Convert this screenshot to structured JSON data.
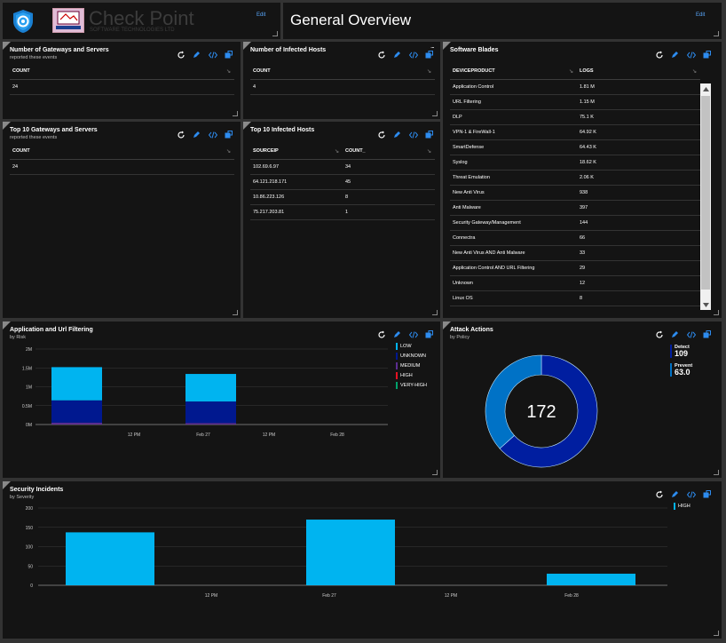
{
  "header": {
    "logo_text": "Check Point",
    "logo_tagline": "SOFTWARE TECHNOLOGIES LTD",
    "edit_left": "Edit",
    "page_title": "General Overview",
    "edit_right": "Edit"
  },
  "tiles": {
    "gateways_count": {
      "title": "Number of Gateways and Servers",
      "subtitle": "reported these events",
      "column": "COUNT",
      "value": "24"
    },
    "infected_count": {
      "title": "Number of Infected Hosts",
      "column": "COUNT",
      "value": "4",
      "more": "..."
    },
    "top_gateways": {
      "title": "Top 10 Gateways and Servers",
      "subtitle": "reported these events",
      "column": "COUNT",
      "value": "24"
    },
    "top_infected": {
      "title": "Top 10 Infected Hosts",
      "columns": [
        "SOURCEIP",
        "COUNT_"
      ],
      "rows": [
        [
          "102.69.6.97",
          "34"
        ],
        [
          "64.121.218.171",
          "45"
        ],
        [
          "10.86.223.126",
          "8"
        ],
        [
          "75.217.203.81",
          "1"
        ]
      ]
    },
    "software_blades": {
      "title": "Software Blades",
      "columns": [
        "DEVICEPRODUCT",
        "LOGS"
      ],
      "rows": [
        [
          "Application Control",
          "1.81 M"
        ],
        [
          "URL Filtering",
          "1.15 M"
        ],
        [
          "DLP",
          "75.1 K"
        ],
        [
          "VPN-1 & FireWall-1",
          "64.92 K"
        ],
        [
          "SmartDefense",
          "64.43 K"
        ],
        [
          "Syslog",
          "18.62 K"
        ],
        [
          "Threat Emulation",
          "2.06 K"
        ],
        [
          "New Anti Virus",
          "938"
        ],
        [
          "Anti Malware",
          "397"
        ],
        [
          "Security Gateway/Management",
          "144"
        ],
        [
          "Connectra",
          "66"
        ],
        [
          "New Anti Virus AND Anti Malware",
          "33"
        ],
        [
          "Application Control AND URL Filtering",
          "29"
        ],
        [
          "Unknown",
          "12"
        ],
        [
          "Linux OS",
          "8"
        ]
      ]
    },
    "app_url": {
      "title": "Application and Url Filtering",
      "subtitle": "by Risk"
    },
    "attack_actions": {
      "title": "Attack Actions",
      "subtitle": "by Policy",
      "center_value": "172"
    },
    "security_incidents": {
      "title": "Security Incidents",
      "subtitle": "by Severity"
    }
  },
  "colors": {
    "low": "#00b4f0",
    "unknown": "#00188f",
    "medium": "#5c2d91",
    "high": "#e81123",
    "very_high": "#00a36c",
    "detect": "#001ea0",
    "prevent": "#0072c6",
    "incident_high": "#00b4f0"
  },
  "chart_data": [
    {
      "type": "bar",
      "title": "Application and Url Filtering",
      "subtitle": "by Risk",
      "stacked": true,
      "y_ticks": [
        "0M",
        "0.5M",
        "1M",
        "1.5M",
        "2M"
      ],
      "ylim": [
        0,
        2000000
      ],
      "x_ticks": [
        "12 PM",
        "Feb 27",
        "12 PM",
        "Feb 28"
      ],
      "categories": [
        "Feb 26 slot",
        "Feb 27 slot"
      ],
      "series": [
        {
          "name": "LOW",
          "values": [
            880000,
            730000
          ]
        },
        {
          "name": "UNKNOWN",
          "values": [
            590000,
            570000
          ]
        },
        {
          "name": "MEDIUM",
          "values": [
            50000,
            40000
          ]
        },
        {
          "name": "HIGH",
          "values": [
            0,
            0
          ]
        },
        {
          "name": "VERY-HIGH",
          "values": [
            0,
            0
          ]
        }
      ],
      "legend": "right"
    },
    {
      "type": "pie",
      "title": "Attack Actions",
      "subtitle": "by Policy",
      "donut": true,
      "total": 172,
      "slices": [
        {
          "name": "Detect",
          "value": 109
        },
        {
          "name": "Prevent",
          "value": 63.0
        }
      ],
      "legend": "right"
    },
    {
      "type": "bar",
      "title": "Security Incidents",
      "subtitle": "by Severity",
      "y_ticks": [
        "0",
        "50",
        "100",
        "150",
        "200"
      ],
      "ylim": [
        0,
        200
      ],
      "x_ticks": [
        "12 PM",
        "Feb 27",
        "12 PM",
        "Feb 28"
      ],
      "categories": [
        "Feb 26 slot",
        "Feb 27 slot",
        "Feb 28 slot"
      ],
      "series": [
        {
          "name": "HIGH",
          "values": [
            137,
            170,
            30
          ]
        }
      ],
      "legend": "right"
    }
  ]
}
